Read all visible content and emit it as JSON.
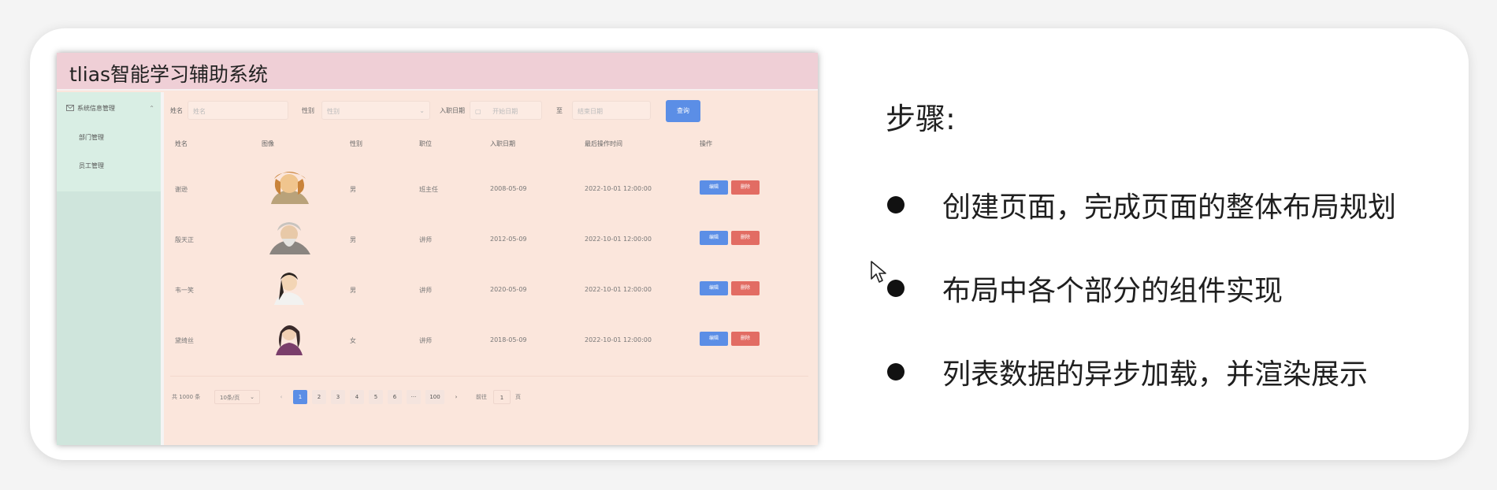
{
  "app": {
    "title": "tlias智能学习辅助系统",
    "sidebar": {
      "group_label": "系统信息管理",
      "items": [
        "部门管理",
        "员工管理"
      ]
    },
    "filters": {
      "name_label": "姓名",
      "name_placeholder": "姓名",
      "gender_label": "性别",
      "gender_placeholder": "性别",
      "entry_date_label": "入职日期",
      "start_placeholder": "开始日期",
      "to_label": "至",
      "end_placeholder": "结束日期",
      "search_label": "查询"
    },
    "table": {
      "columns": [
        "姓名",
        "图像",
        "性别",
        "职位",
        "入职日期",
        "最后操作时间",
        "操作"
      ],
      "rows": [
        {
          "name": "谢逊",
          "gender": "男",
          "position": "班主任",
          "entry_date": "2008-05-09",
          "updated": "2022-10-01 12:00:00"
        },
        {
          "name": "殷天正",
          "gender": "男",
          "position": "讲师",
          "entry_date": "2012-05-09",
          "updated": "2022-10-01 12:00:00"
        },
        {
          "name": "韦一笑",
          "gender": "男",
          "position": "讲师",
          "entry_date": "2020-05-09",
          "updated": "2022-10-01 12:00:00"
        },
        {
          "name": "黛绮丝",
          "gender": "女",
          "position": "讲师",
          "entry_date": "2018-05-09",
          "updated": "2022-10-01 12:00:00"
        }
      ],
      "edit_label": "编辑",
      "delete_label": "删除"
    },
    "pagination": {
      "total": "共 1000 条",
      "page_size": "10条/页",
      "pages": [
        "1",
        "2",
        "3",
        "4",
        "5",
        "6"
      ],
      "ellipsis": "···",
      "last_page": "100",
      "goto_label": "前往",
      "goto_value": "1",
      "page_unit": "页",
      "current": "1"
    }
  },
  "slide": {
    "steps_title": "步骤:",
    "steps": [
      "创建页面，完成页面的整体布局规划",
      "布局中各个部分的组件实现",
      "列表数据的异步加载，并渲染展示"
    ]
  }
}
